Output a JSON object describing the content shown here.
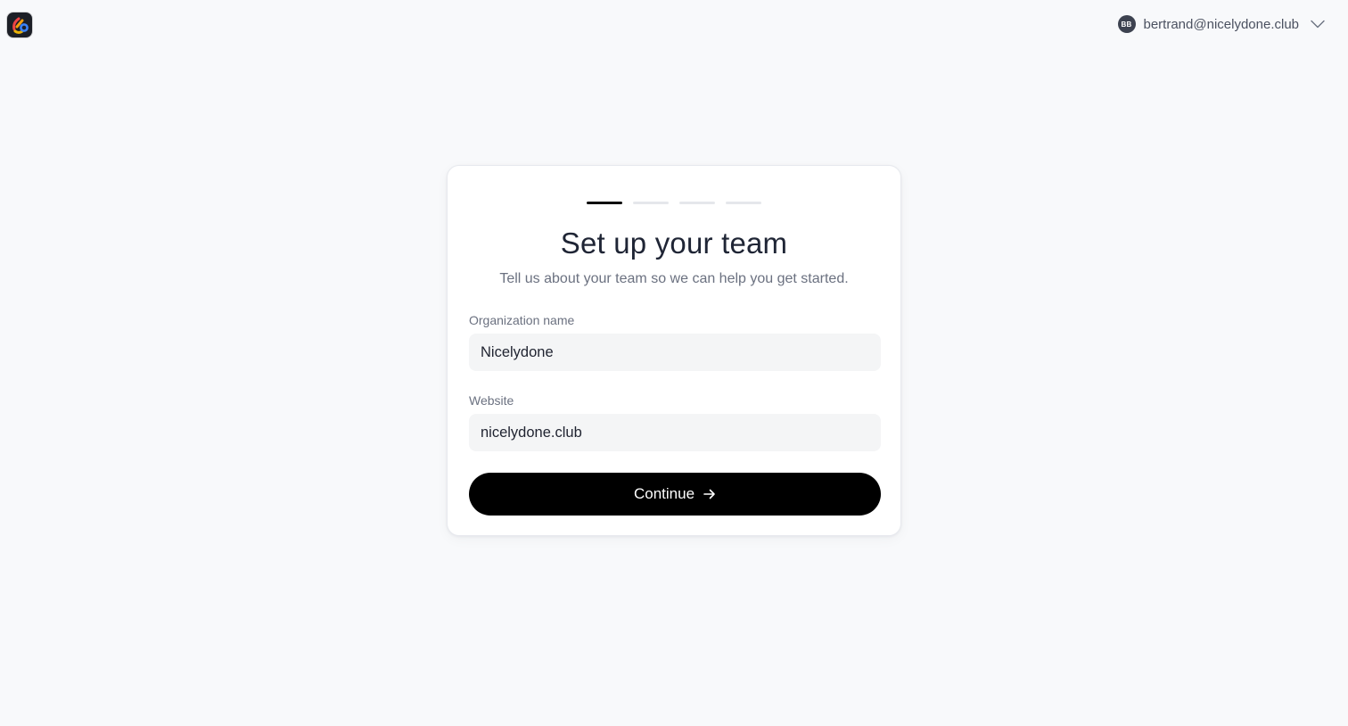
{
  "app": {
    "logo_icon": "app-logo-icon"
  },
  "account": {
    "avatar_initials": "BB",
    "email": "bertrand@nicelydone.club",
    "menu_icon": "chevron-down-icon"
  },
  "onboarding": {
    "progress": {
      "current_step": 1,
      "total_steps": 4
    },
    "title": "Set up your team",
    "subtitle": "Tell us about your team so we can help you get started.",
    "fields": {
      "organization": {
        "label": "Organization name",
        "value": "Nicelydone"
      },
      "website": {
        "label": "Website",
        "value": "nicelydone.club"
      }
    },
    "continue_label": "Continue",
    "continue_icon": "arrow-right-icon"
  },
  "colors": {
    "background": "#f8f9fb",
    "primary_button": "#000000",
    "step_active": "#0a0a0a",
    "step_inactive": "#e5e7eb"
  }
}
